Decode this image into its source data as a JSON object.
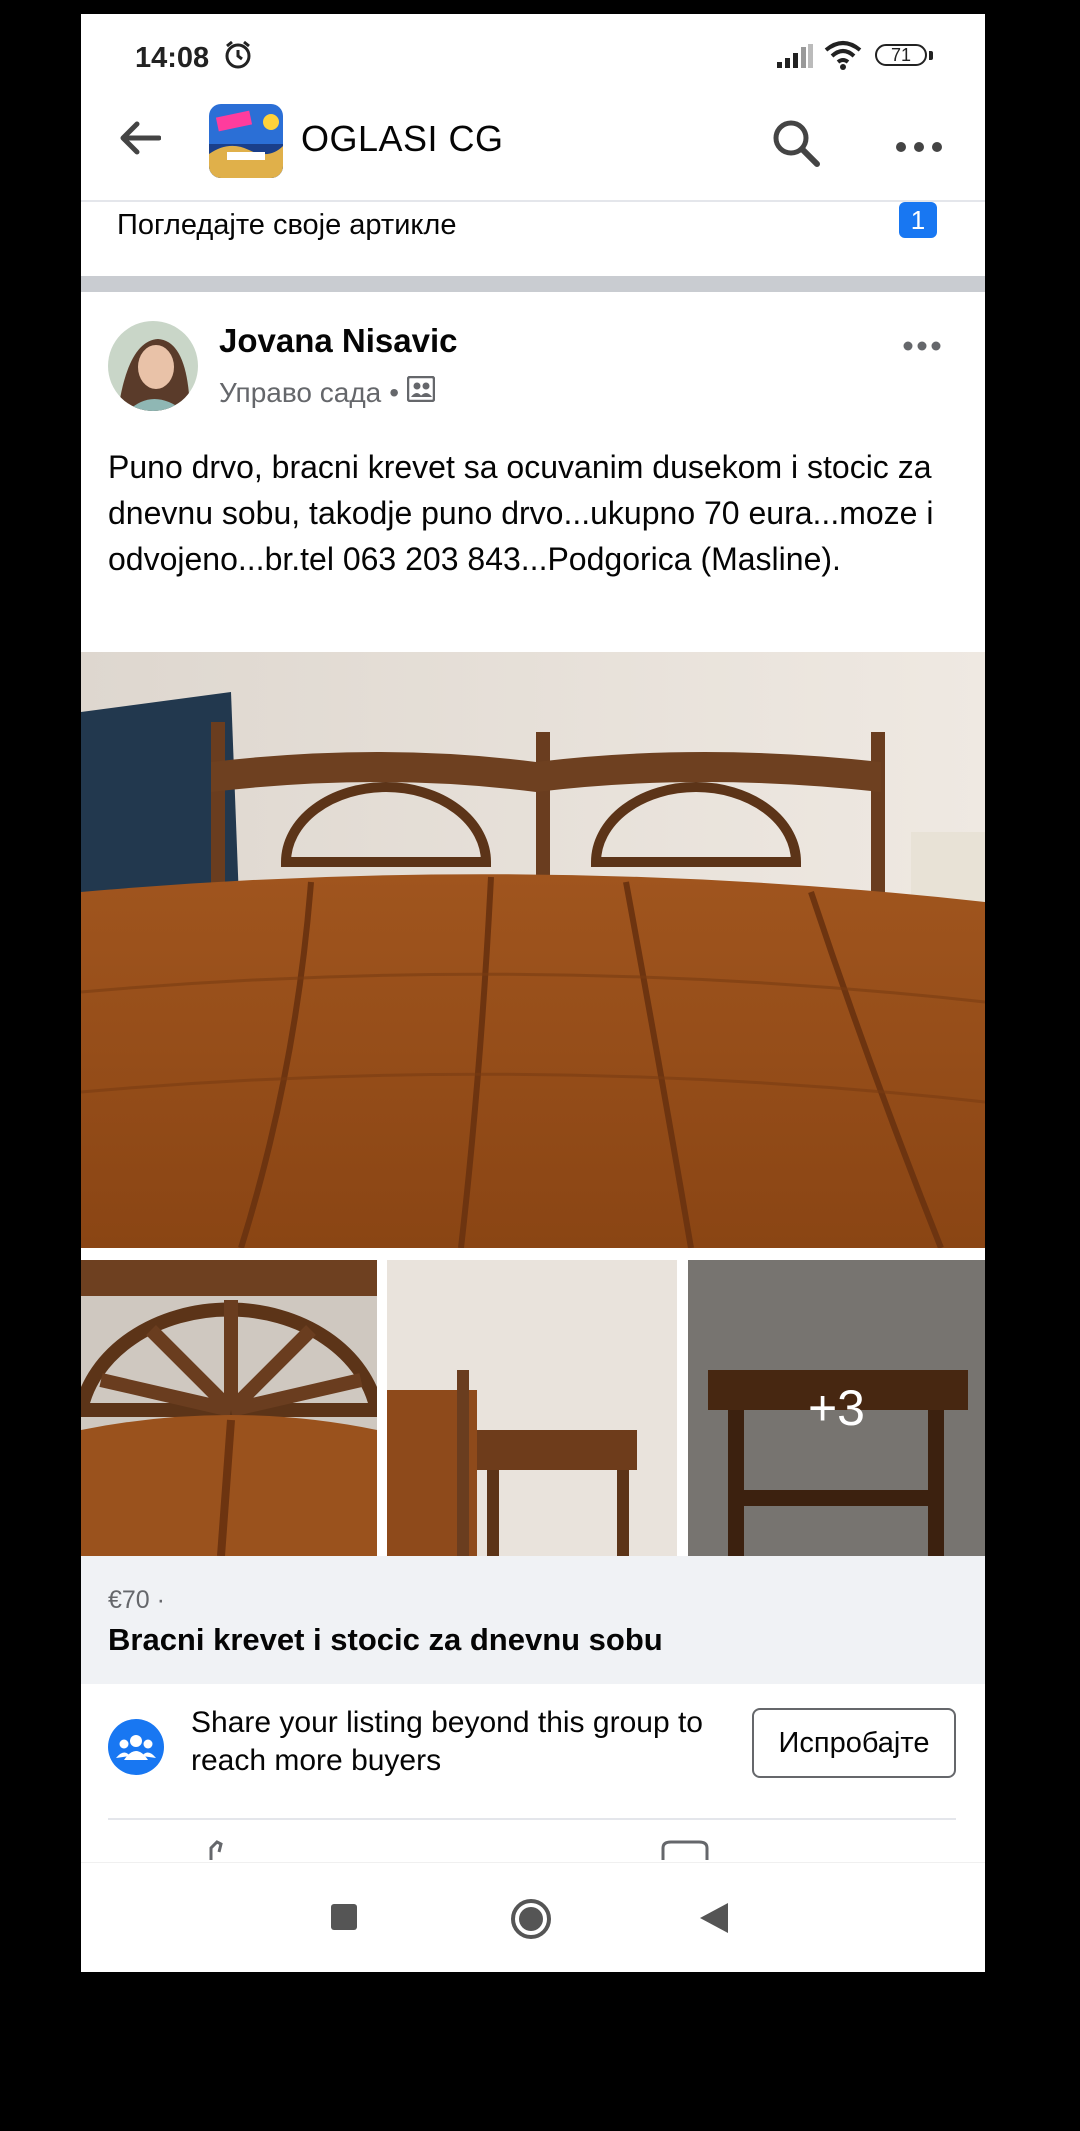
{
  "status_bar": {
    "time": "14:08",
    "battery": "71",
    "icons": [
      "alarm-icon",
      "signal-icon",
      "wifi-icon",
      "battery-icon"
    ]
  },
  "header": {
    "group_name": "OGLASI CG",
    "icons": [
      "back-arrow-icon",
      "search-icon",
      "more-options-icon"
    ]
  },
  "items_banner": {
    "label": "Погледајте своје артикле",
    "badge": "1"
  },
  "post": {
    "author": "Jovana Nisavic",
    "time": "Управо сада",
    "dot": "•",
    "text": "Puno drvo, bracni krevet sa ocuvanim dusekom i stocic za dnevnu sobu, takodje puno drvo...ukupno 70 eura...moze i odvojeno...br.tel 063 203 843...Podgorica (Masline).",
    "more_photos": "+3"
  },
  "listing": {
    "price": "€70 ·",
    "title": "Bracni krevet i stocic za dnevnu sobu"
  },
  "share": {
    "text": "Share your listing beyond this group to reach more buyers",
    "button": "Испробајте"
  },
  "colors": {
    "accent": "#1877f2",
    "secondary_text": "#65676b",
    "listing_bg": "#f0f2f5",
    "separator": "#c9ccd1"
  }
}
